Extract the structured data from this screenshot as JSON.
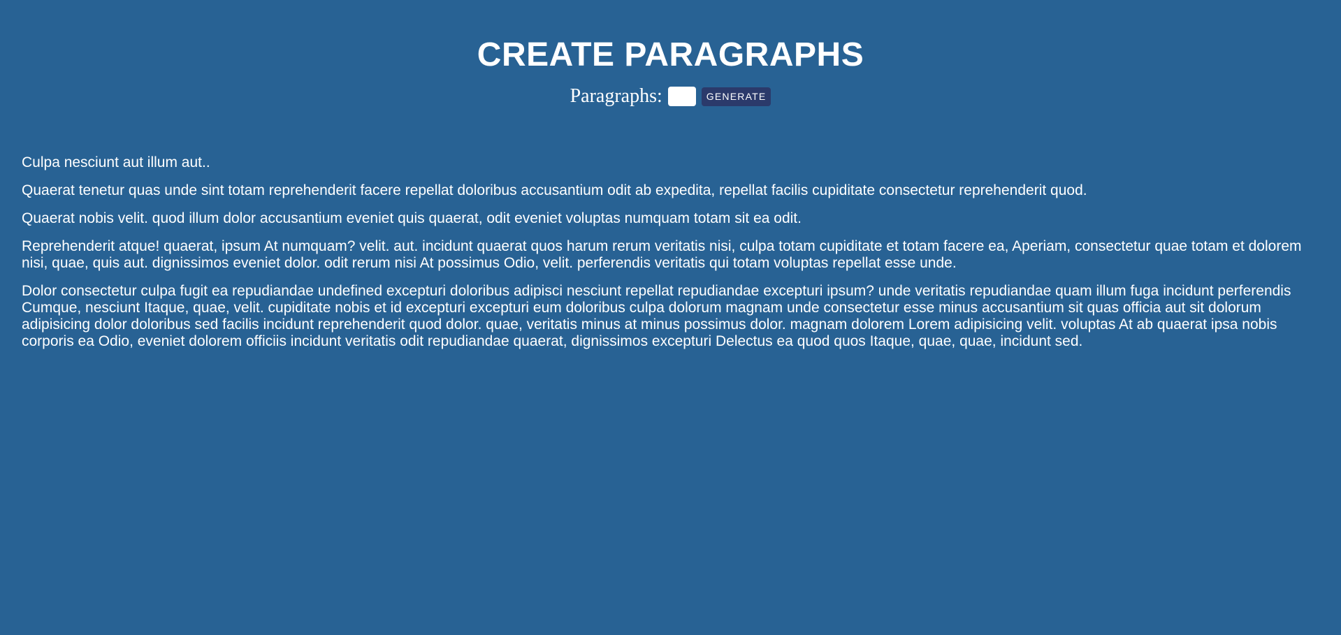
{
  "page": {
    "title": "CREATE PARAGRAPHS"
  },
  "form": {
    "label": "Paragraphs:",
    "input_value": "",
    "generate_label": "GENERATE"
  },
  "paragraphs": [
    "Culpa nesciunt aut illum aut..",
    "Quaerat tenetur quas unde sint totam reprehenderit facere repellat doloribus accusantium odit ab expedita, repellat facilis cupiditate consectetur reprehenderit quod.",
    "Quaerat nobis velit. quod illum dolor accusantium eveniet quis quaerat, odit eveniet voluptas numquam totam sit ea odit.",
    "Reprehenderit atque! quaerat, ipsum At numquam? velit. aut. incidunt quaerat quos harum rerum veritatis nisi, culpa totam cupiditate et totam facere ea, Aperiam, consectetur quae totam et dolorem nisi, quae, quis aut. dignissimos eveniet dolor. odit rerum nisi At possimus Odio, velit. perferendis veritatis qui totam voluptas repellat esse unde.",
    "Dolor consectetur culpa fugit ea repudiandae undefined excepturi doloribus adipisci nesciunt repellat repudiandae excepturi ipsum? unde veritatis repudiandae quam illum fuga incidunt perferendis Cumque, nesciunt Itaque, quae, velit. cupiditate nobis et id excepturi excepturi eum doloribus culpa dolorum magnam unde consectetur esse minus accusantium sit quas officia aut sit dolorum adipisicing dolor doloribus sed facilis incidunt reprehenderit quod dolor. quae, veritatis minus at minus possimus dolor. magnam dolorem Lorem adipisicing velit. voluptas At ab quaerat ipsa nobis corporis ea Odio, eveniet dolorem officiis incidunt veritatis odit repudiandae quaerat, dignissimos excepturi Delectus ea quod quos Itaque, quae, quae, incidunt sed."
  ],
  "colors": {
    "background": "#286294",
    "button": "#2b3a6b",
    "text": "#ffffff"
  }
}
